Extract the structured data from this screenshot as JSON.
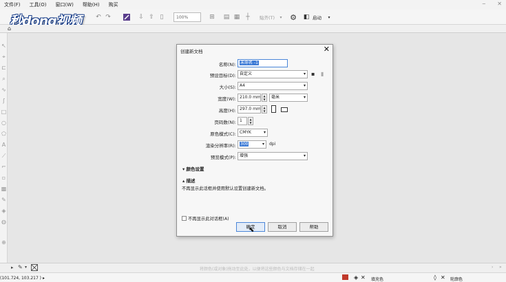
{
  "menu": [
    "文件(F)",
    "工具(O)",
    "窗口(W)",
    "帮助(H)",
    "购买"
  ],
  "logo": "秒dong视频",
  "toolbar": {
    "zoom": "100%",
    "snap_label": "贴齐(T)",
    "launch_label": "启动"
  },
  "dialog": {
    "title": "创建新文档",
    "fields": {
      "name_label": "名称(N):",
      "name_value": "未命名 -1",
      "preset_label": "预设目标(D):",
      "preset_value": "自定义",
      "size_label": "大小(S):",
      "size_value": "A4",
      "width_label": "宽度(W):",
      "width_value": "210.0 mm",
      "width_unit": "毫米",
      "height_label": "高度(H):",
      "height_value": "297.0 mm",
      "pages_label": "页码数(N):",
      "pages_value": "1",
      "color_mode_label": "原色模式(C):",
      "color_mode_value": "CMYK",
      "resolution_label": "渲染分辨率(R):",
      "resolution_value": "300",
      "resolution_unit": "dpi",
      "preview_label": "预览模式(P):",
      "preview_value": "增强"
    },
    "sections": {
      "color_settings": "颜色设置",
      "description": "描述"
    },
    "description_text": "不再显示此话框并使用默认设置创建新文档。",
    "dont_show_label": "不再显示此对话框(A)",
    "buttons": {
      "ok": "确定",
      "cancel": "取消",
      "help": "帮助"
    }
  },
  "palette_hint": "将颜色(或对象)拖动至此处，以便将这些颜色与文档存储在一起",
  "status": {
    "coords": "(101.724, 103.217 )",
    "fill_label": "填充色",
    "outline_label": "轮廓色"
  },
  "colors": {
    "accent": "#3d7bd6",
    "logo_outline": "#1a3f8a"
  }
}
